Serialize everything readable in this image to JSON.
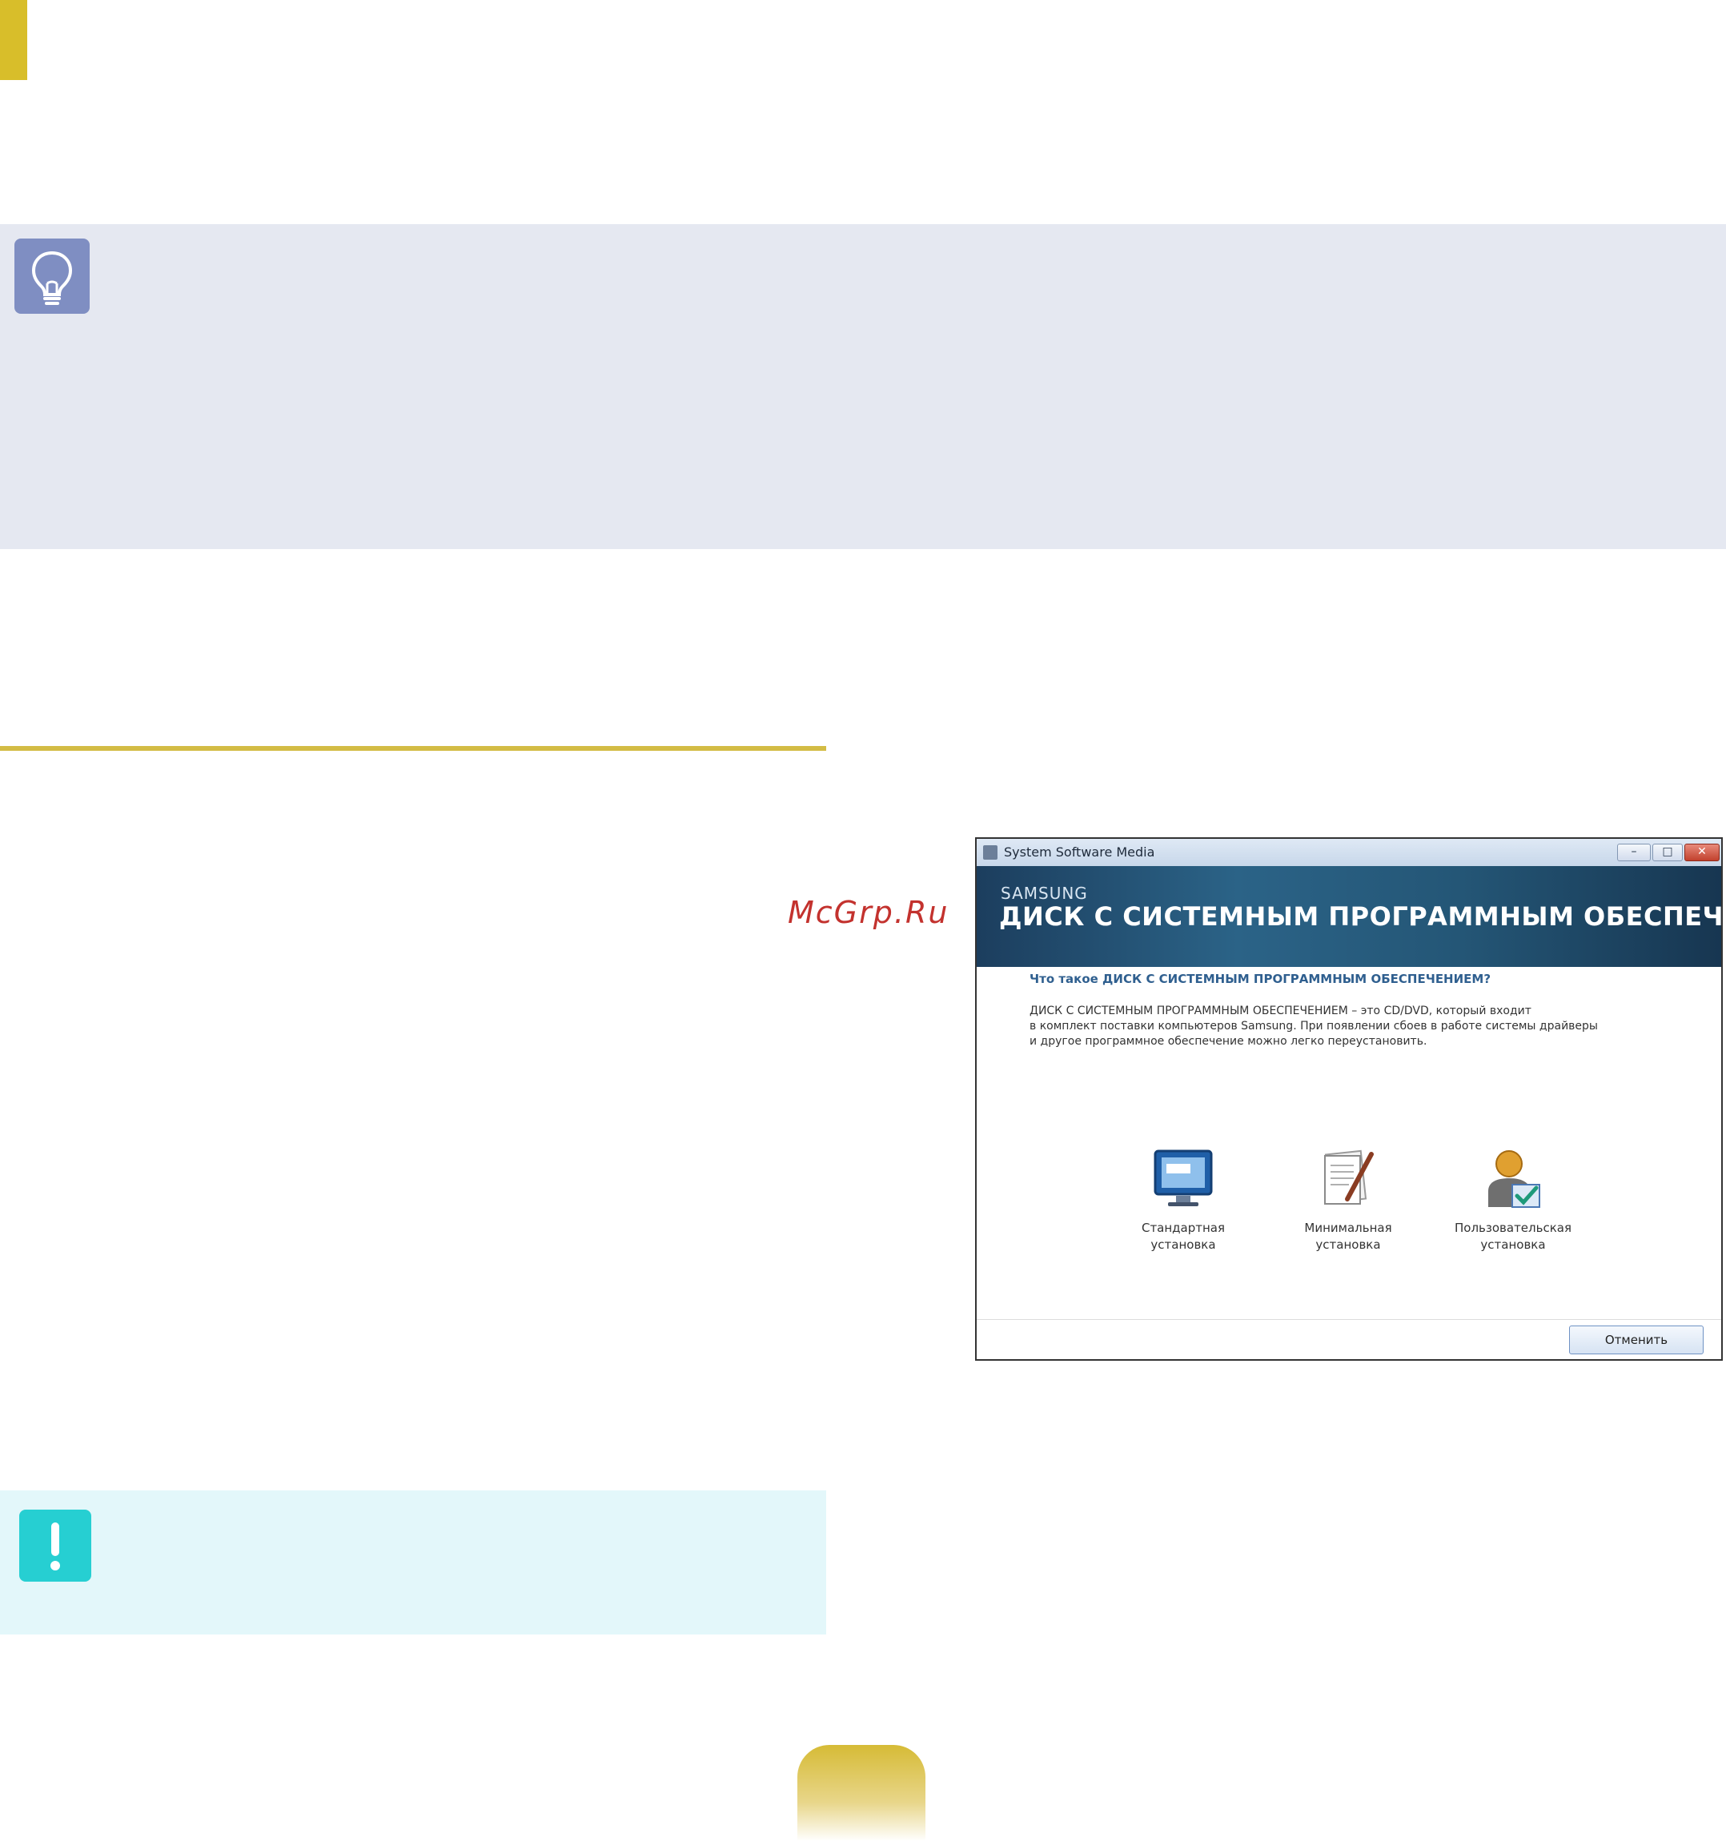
{
  "watermark": "McGrp.Ru",
  "colors": {
    "accent_gold": "#d3bc45",
    "tip_panel_bg": "#e5e8f1",
    "tip_icon_bg": "#7f8ec2",
    "warning_panel_bg": "#e3f7fa",
    "warning_icon_bg": "#26cfd2",
    "watermark": "#c3322e"
  },
  "icons": {
    "tip": "lightbulb-icon",
    "warning": "exclamation-icon"
  },
  "screenshot": {
    "window_title": "System Software Media",
    "buttons": {
      "minimize": "–",
      "maximize": "□",
      "close": "✕"
    },
    "brand": "SAMSUNG",
    "banner_title": "ДИСК С СИСТЕМНЫМ ПРОГРАММНЫМ ОБЕСПЕЧЕНИЕМ",
    "heading": "Что такое ДИСК С СИСТЕМНЫМ ПРОГРАММНЫМ ОБЕСПЕЧЕНИЕМ?",
    "body_lines": [
      "ДИСК С СИСТЕМНЫМ ПРОГРАММНЫМ ОБЕСПЕЧЕНИЕМ – это CD/DVD, который входит",
      "в комплект поставки компьютеров Samsung. При появлении сбоев в работе системы драйверы",
      "и другое программное обеспечение можно легко переустановить."
    ],
    "options": [
      {
        "line1": "Стандартная",
        "line2": "установка",
        "icon": "monitor-icon"
      },
      {
        "line1": "Минимальная",
        "line2": "установка",
        "icon": "document-pen-icon"
      },
      {
        "line1": "Пользовательская",
        "line2": "установка",
        "icon": "user-check-icon"
      }
    ],
    "cancel_label": "Отменить"
  }
}
